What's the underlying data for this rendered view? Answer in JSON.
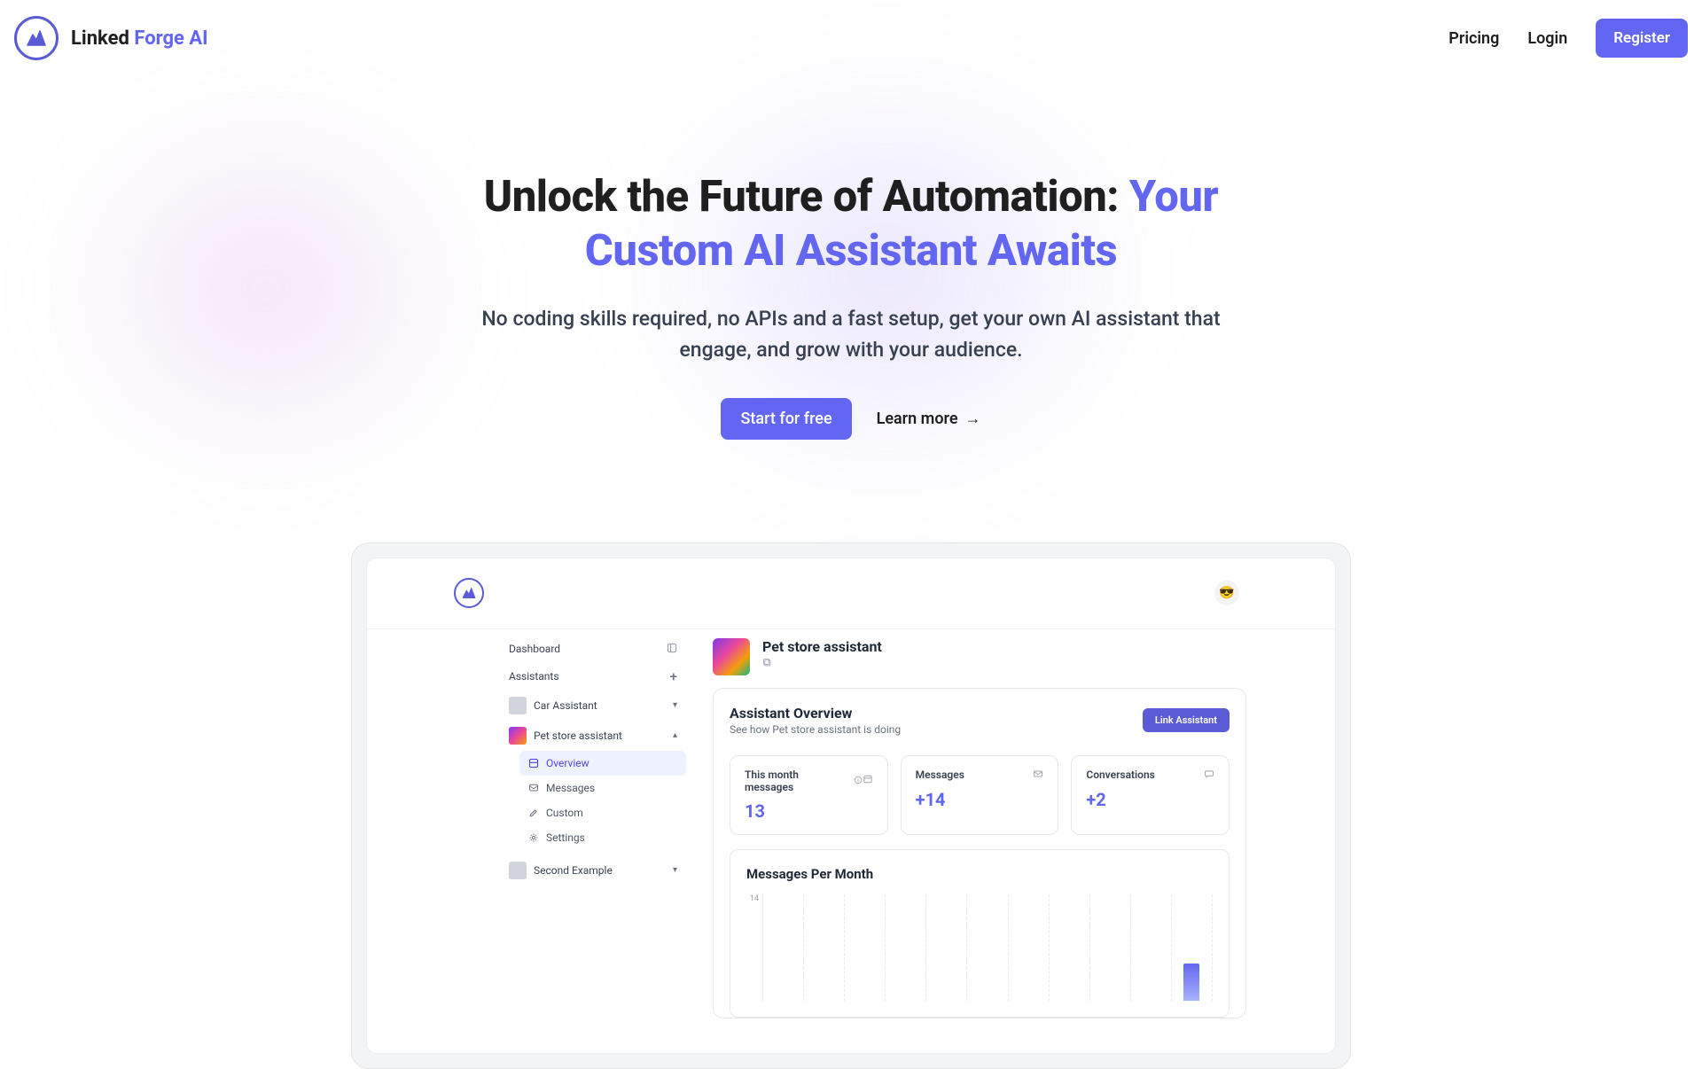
{
  "nav": {
    "brand_linked": "Linked",
    "brand_forge": " Forge AI",
    "pricing": "Pricing",
    "login": "Login",
    "register": "Register"
  },
  "hero": {
    "title_prefix": "Unlock the Future of Automation: ",
    "title_highlight": "Your Custom AI Assistant Awaits",
    "sub_line1": "No coding skills required, no APIs and a fast setup, get your own AI assistant that",
    "sub_line2": "engage, and grow with your audience.",
    "cta_primary": "Start for free",
    "cta_secondary": "Learn more"
  },
  "preview": {
    "sidebar": {
      "dashboard": "Dashboard",
      "assistants": "Assistants",
      "asst1": "Car Assistant",
      "asst2": "Pet store assistant",
      "overview": "Overview",
      "messages": "Messages",
      "custom": "Custom",
      "settings": "Settings",
      "asst3": "Second Example"
    },
    "main": {
      "title": "Pet store assistant",
      "overview_title": "Assistant Overview",
      "overview_sub": "See how Pet store assistant is doing",
      "link_btn": "Link Assistant",
      "stat1_label": "This month messages",
      "stat1_value": "13",
      "stat2_label": "Messages",
      "stat2_value": "+14",
      "stat3_label": "Conversations",
      "stat3_value": "+2",
      "chart_title": "Messages Per Month",
      "chart_ylabel": "14"
    }
  },
  "colors": {
    "accent": "#6366f1"
  }
}
